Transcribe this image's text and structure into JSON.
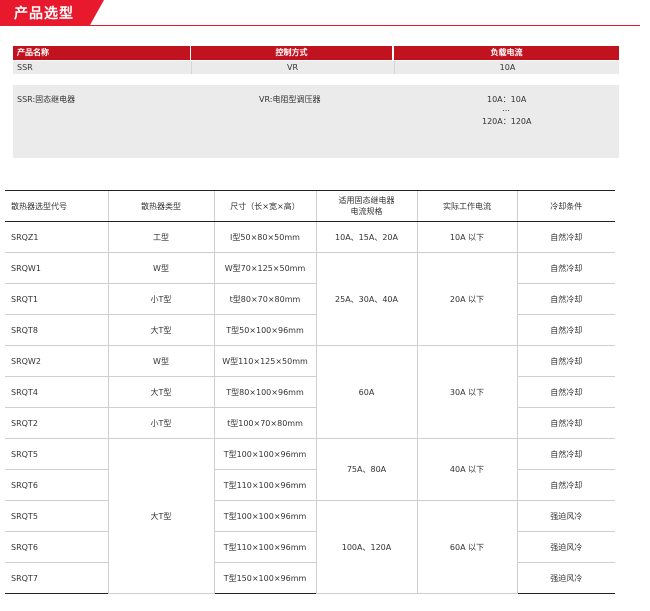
{
  "header": {
    "title": "产品选型"
  },
  "selection": {
    "headers": [
      "产品名称",
      "控制方式",
      "负载电流"
    ],
    "values": [
      "SSR",
      "VR",
      "10A"
    ],
    "notes": {
      "product": "SSR:固态继电器",
      "control": "VR:电阻型调压器",
      "load_1": "10A：10A",
      "load_2": "…",
      "load_3": "120A：120A"
    }
  },
  "table": {
    "headers": [
      "散热器选型代号",
      "散热器类型",
      "尺寸（长×宽×高）",
      "适用固态继电器\n电流规格",
      "实际工作电流",
      "冷却条件"
    ],
    "models": [
      "SRQZ1",
      "SRQW1",
      "SRQT1",
      "SRQT8",
      "SRQW2",
      "SRQT4",
      "SRQT2",
      "SRQT5",
      "SRQT6",
      "SRQT5",
      "SRQT6",
      "SRQT7"
    ],
    "types": [
      "工型",
      "W型",
      "小T型",
      "大T型",
      "W型",
      "大T型",
      "小T型",
      "大T型"
    ],
    "sizes": [
      "I型50×80×50mm",
      "W型70×125×50mm",
      "t型80×70×80mm",
      "T型50×100×96mm",
      "W型110×125×50mm",
      "T型80×100×96mm",
      "t型100×70×80mm",
      "T型100×100×96mm",
      "T型110×100×96mm",
      "T型100×100×96mm",
      "T型110×100×96mm",
      "T型150×100×96mm"
    ],
    "ratings": [
      "10A、15A、20A",
      "25A、30A、40A",
      "60A",
      "75A、80A",
      "100A、120A"
    ],
    "currents": [
      "10A 以下",
      "20A 以下",
      "30A 以下",
      "40A 以下",
      "60A 以下"
    ],
    "cooling": [
      "自然冷却",
      "自然冷却",
      "自然冷却",
      "自然冷却",
      "自然冷却",
      "自然冷却",
      "自然冷却",
      "自然冷却",
      "自然冷却",
      "强迫风冷",
      "强迫风冷",
      "强迫风冷"
    ]
  }
}
